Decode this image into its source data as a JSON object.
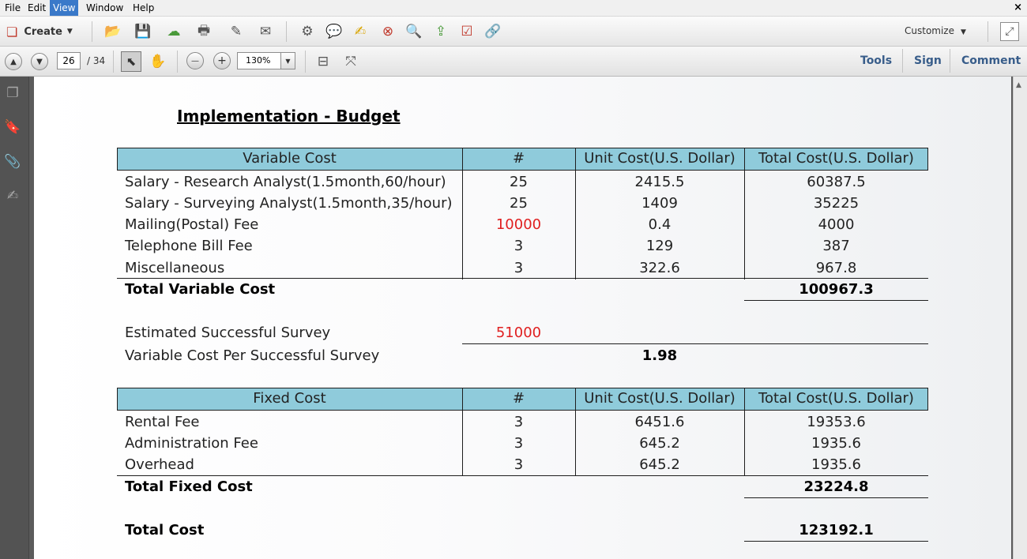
{
  "menu": {
    "items": [
      "File",
      "Edit",
      "View",
      "Window",
      "Help"
    ],
    "active": "View",
    "close_glyph": "×"
  },
  "toolbar": {
    "create_label": "Create",
    "customize_label": "Customize",
    "icons": [
      "open-folder-icon",
      "save-icon",
      "cloud-upload-icon",
      "print-icon",
      "edit-icon",
      "email-icon",
      "gear-icon",
      "comment-icon",
      "sticky-note-icon",
      "pdf-delete-icon",
      "search-doc-icon",
      "export-icon",
      "form-icon",
      "link-icon"
    ]
  },
  "nav": {
    "current_page": "26",
    "total_pages": "/ 34",
    "zoom": "130%",
    "right_tabs": {
      "tools": "Tools",
      "sign": "Sign",
      "comment": "Comment"
    }
  },
  "document": {
    "title": "Implementation - Budget",
    "variable_table": {
      "headers": [
        "Variable Cost",
        "#",
        "Unit Cost(U.S. Dollar)",
        "Total Cost(U.S. Dollar)"
      ],
      "rows": [
        {
          "item": "Salary - Research Analyst(1.5month,60/hour)",
          "qty": "25",
          "unit": "2415.5",
          "total": "60387.5"
        },
        {
          "item": "Salary - Surveying Analyst(1.5month,35/hour)",
          "qty": "25",
          "unit": "1409",
          "total": "35225"
        },
        {
          "item": "Mailing(Postal) Fee",
          "qty": "10000",
          "unit": "0.4",
          "total": "4000"
        },
        {
          "item": "Telephone Bill Fee",
          "qty": "3",
          "unit": "129",
          "total": "387"
        },
        {
          "item": "Miscellaneous",
          "qty": "3",
          "unit": "322.6",
          "total": "967.8"
        }
      ],
      "total_label": "Total Variable Cost",
      "total_value": "100967.3"
    },
    "survey": {
      "estimated_label": "Estimated Successful Survey",
      "estimated_value": "51000",
      "per_survey_label": "Variable Cost Per Successful Survey",
      "per_survey_value": "1.98"
    },
    "fixed_table": {
      "headers": [
        "Fixed Cost",
        "#",
        "Unit Cost(U.S. Dollar)",
        "Total Cost(U.S. Dollar)"
      ],
      "rows": [
        {
          "item": "Rental Fee",
          "qty": "3",
          "unit": "6451.6",
          "total": "19353.6"
        },
        {
          "item": "Administration Fee",
          "qty": "3",
          "unit": "645.2",
          "total": "1935.6"
        },
        {
          "item": "Overhead",
          "qty": "3",
          "unit": "645.2",
          "total": "1935.6"
        }
      ],
      "total_label": "Total Fixed Cost",
      "total_value": "23224.8"
    },
    "grand_total_label": "Total Cost",
    "grand_total_value": "123192.1"
  },
  "colors": {
    "table_header": "#8fcbdb",
    "highlight_text": "#e02020",
    "tab_text": "#385d8a",
    "menu_active": "#3a79c9"
  }
}
